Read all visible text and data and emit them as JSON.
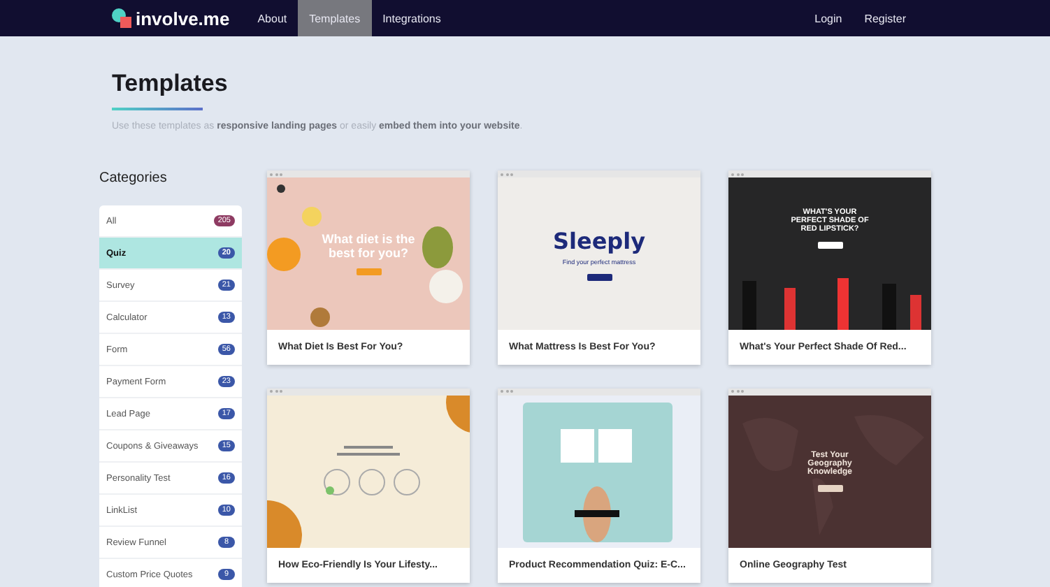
{
  "nav": {
    "brand": "involve.me",
    "links": [
      {
        "label": "About",
        "selected": false
      },
      {
        "label": "Templates",
        "selected": true
      },
      {
        "label": "Integrations",
        "selected": false
      }
    ],
    "account": [
      "Login",
      "Register"
    ]
  },
  "header": {
    "title": "Templates",
    "subtitle": "Use these templates as **responsive landing pages** or easily **embed them into your website**."
  },
  "categories": {
    "title": "Categories",
    "items": [
      {
        "label": "All",
        "count": "205",
        "selected": false,
        "color": "#8e3b62"
      },
      {
        "label": "Quiz",
        "count": "20",
        "selected": true,
        "color": "#3b57a8"
      },
      {
        "label": "Survey",
        "count": "21",
        "selected": false,
        "color": "#3b57a8"
      },
      {
        "label": "Calculator",
        "count": "13",
        "selected": false,
        "color": "#3b57a8"
      },
      {
        "label": "Form",
        "count": "56",
        "selected": false,
        "color": "#3b57a8"
      },
      {
        "label": "Payment Form",
        "count": "23",
        "selected": false,
        "color": "#3b57a8"
      },
      {
        "label": "Lead Page",
        "count": "17",
        "selected": false,
        "color": "#3b57a8"
      },
      {
        "label": "Coupons & Giveaways",
        "count": "15",
        "selected": false,
        "color": "#3b57a8"
      },
      {
        "label": "Personality Test",
        "count": "16",
        "selected": false,
        "color": "#3b57a8"
      },
      {
        "label": "LinkList",
        "count": "10",
        "selected": false,
        "color": "#3b57a8"
      },
      {
        "label": "Review Funnel",
        "count": "8",
        "selected": false,
        "color": "#3b57a8"
      },
      {
        "label": "Custom Price Quotes",
        "count": "9",
        "selected": false,
        "color": "#3b57a8"
      }
    ]
  },
  "templates": [
    {
      "kind": "diet",
      "title": "What Diet Is Best For You?",
      "headline": "What diet is the best for you?"
    },
    {
      "kind": "mattress",
      "title": "What Mattress Is Best For You?",
      "headline": "Sleeply",
      "tagline": "Find your perfect mattress"
    },
    {
      "kind": "lipstick",
      "title": "What's Your Perfect Shade Of Red...",
      "headline": "WHAT'S YOUR PERFECT SHADE OF RED LIPSTICK?"
    },
    {
      "kind": "eco",
      "title": "How Eco-Friendly Is Your Lifesty..."
    },
    {
      "kind": "glasses",
      "title": "Product Recommendation Quiz: E-C..."
    },
    {
      "kind": "geography",
      "title": "Online Geography Test",
      "headline": "Test Your Geography Knowledge"
    }
  ]
}
